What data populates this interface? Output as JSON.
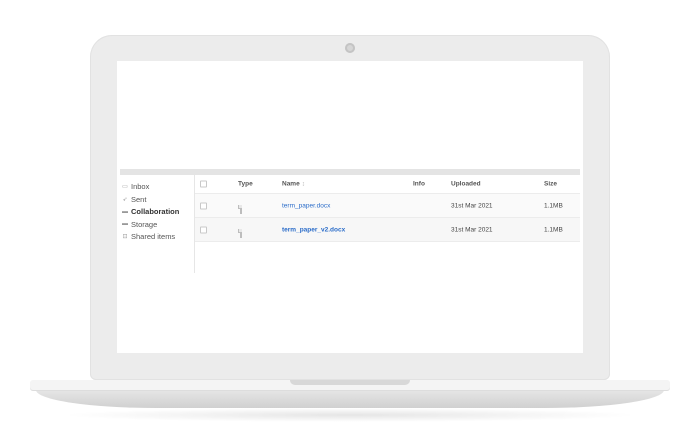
{
  "sidebar": {
    "items": [
      {
        "label": "Inbox",
        "icon": "inbox-icon",
        "glyph": "▭"
      },
      {
        "label": "Sent",
        "icon": "send-icon",
        "glyph": "➶"
      },
      {
        "label": "Collaboration",
        "icon": "folder-icon",
        "glyph": "▬",
        "active": true
      },
      {
        "label": "Storage",
        "icon": "storage-folder-icon",
        "glyph": "▬"
      },
      {
        "label": "Shared items",
        "icon": "shared-items-icon",
        "glyph": "⊡"
      }
    ]
  },
  "table": {
    "headers": {
      "type": "Type",
      "name": "Name",
      "sort_glyph": "↕",
      "info": "Info",
      "uploaded": "Uploaded",
      "size": "Size"
    },
    "rows": [
      {
        "name": "term_paper.docx",
        "uploaded": "31st Mar 2021",
        "size": "1.1MB",
        "icon": "document-icon"
      },
      {
        "name": "term_paper_v2.docx",
        "uploaded": "31st Mar 2021",
        "size": "1.1MB",
        "icon": "document-icon"
      }
    ]
  },
  "colors": {
    "link": "#2a6cc9",
    "laptop_body": "#ececec"
  }
}
